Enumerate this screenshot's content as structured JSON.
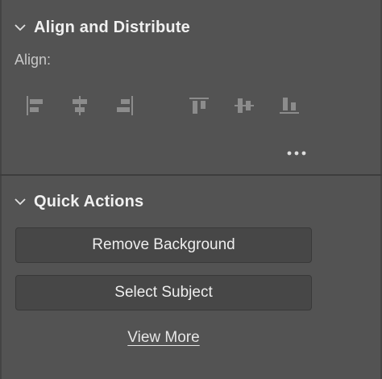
{
  "align_section": {
    "title": "Align and Distribute",
    "align_label": "Align:",
    "icons": [
      "align-left-edges-icon",
      "align-horizontal-centers-icon",
      "align-right-edges-icon",
      "align-top-edges-icon",
      "align-vertical-centers-icon",
      "align-bottom-edges-icon"
    ],
    "more_icon": "more-options-icon"
  },
  "quick_actions": {
    "title": "Quick Actions",
    "buttons": [
      "Remove Background",
      "Select Subject"
    ],
    "view_more": "View More"
  },
  "colors": {
    "panel_bg": "#535353",
    "button_bg": "#474747",
    "icon_color": "#8c8c8c",
    "text_color": "#eeeeee"
  }
}
